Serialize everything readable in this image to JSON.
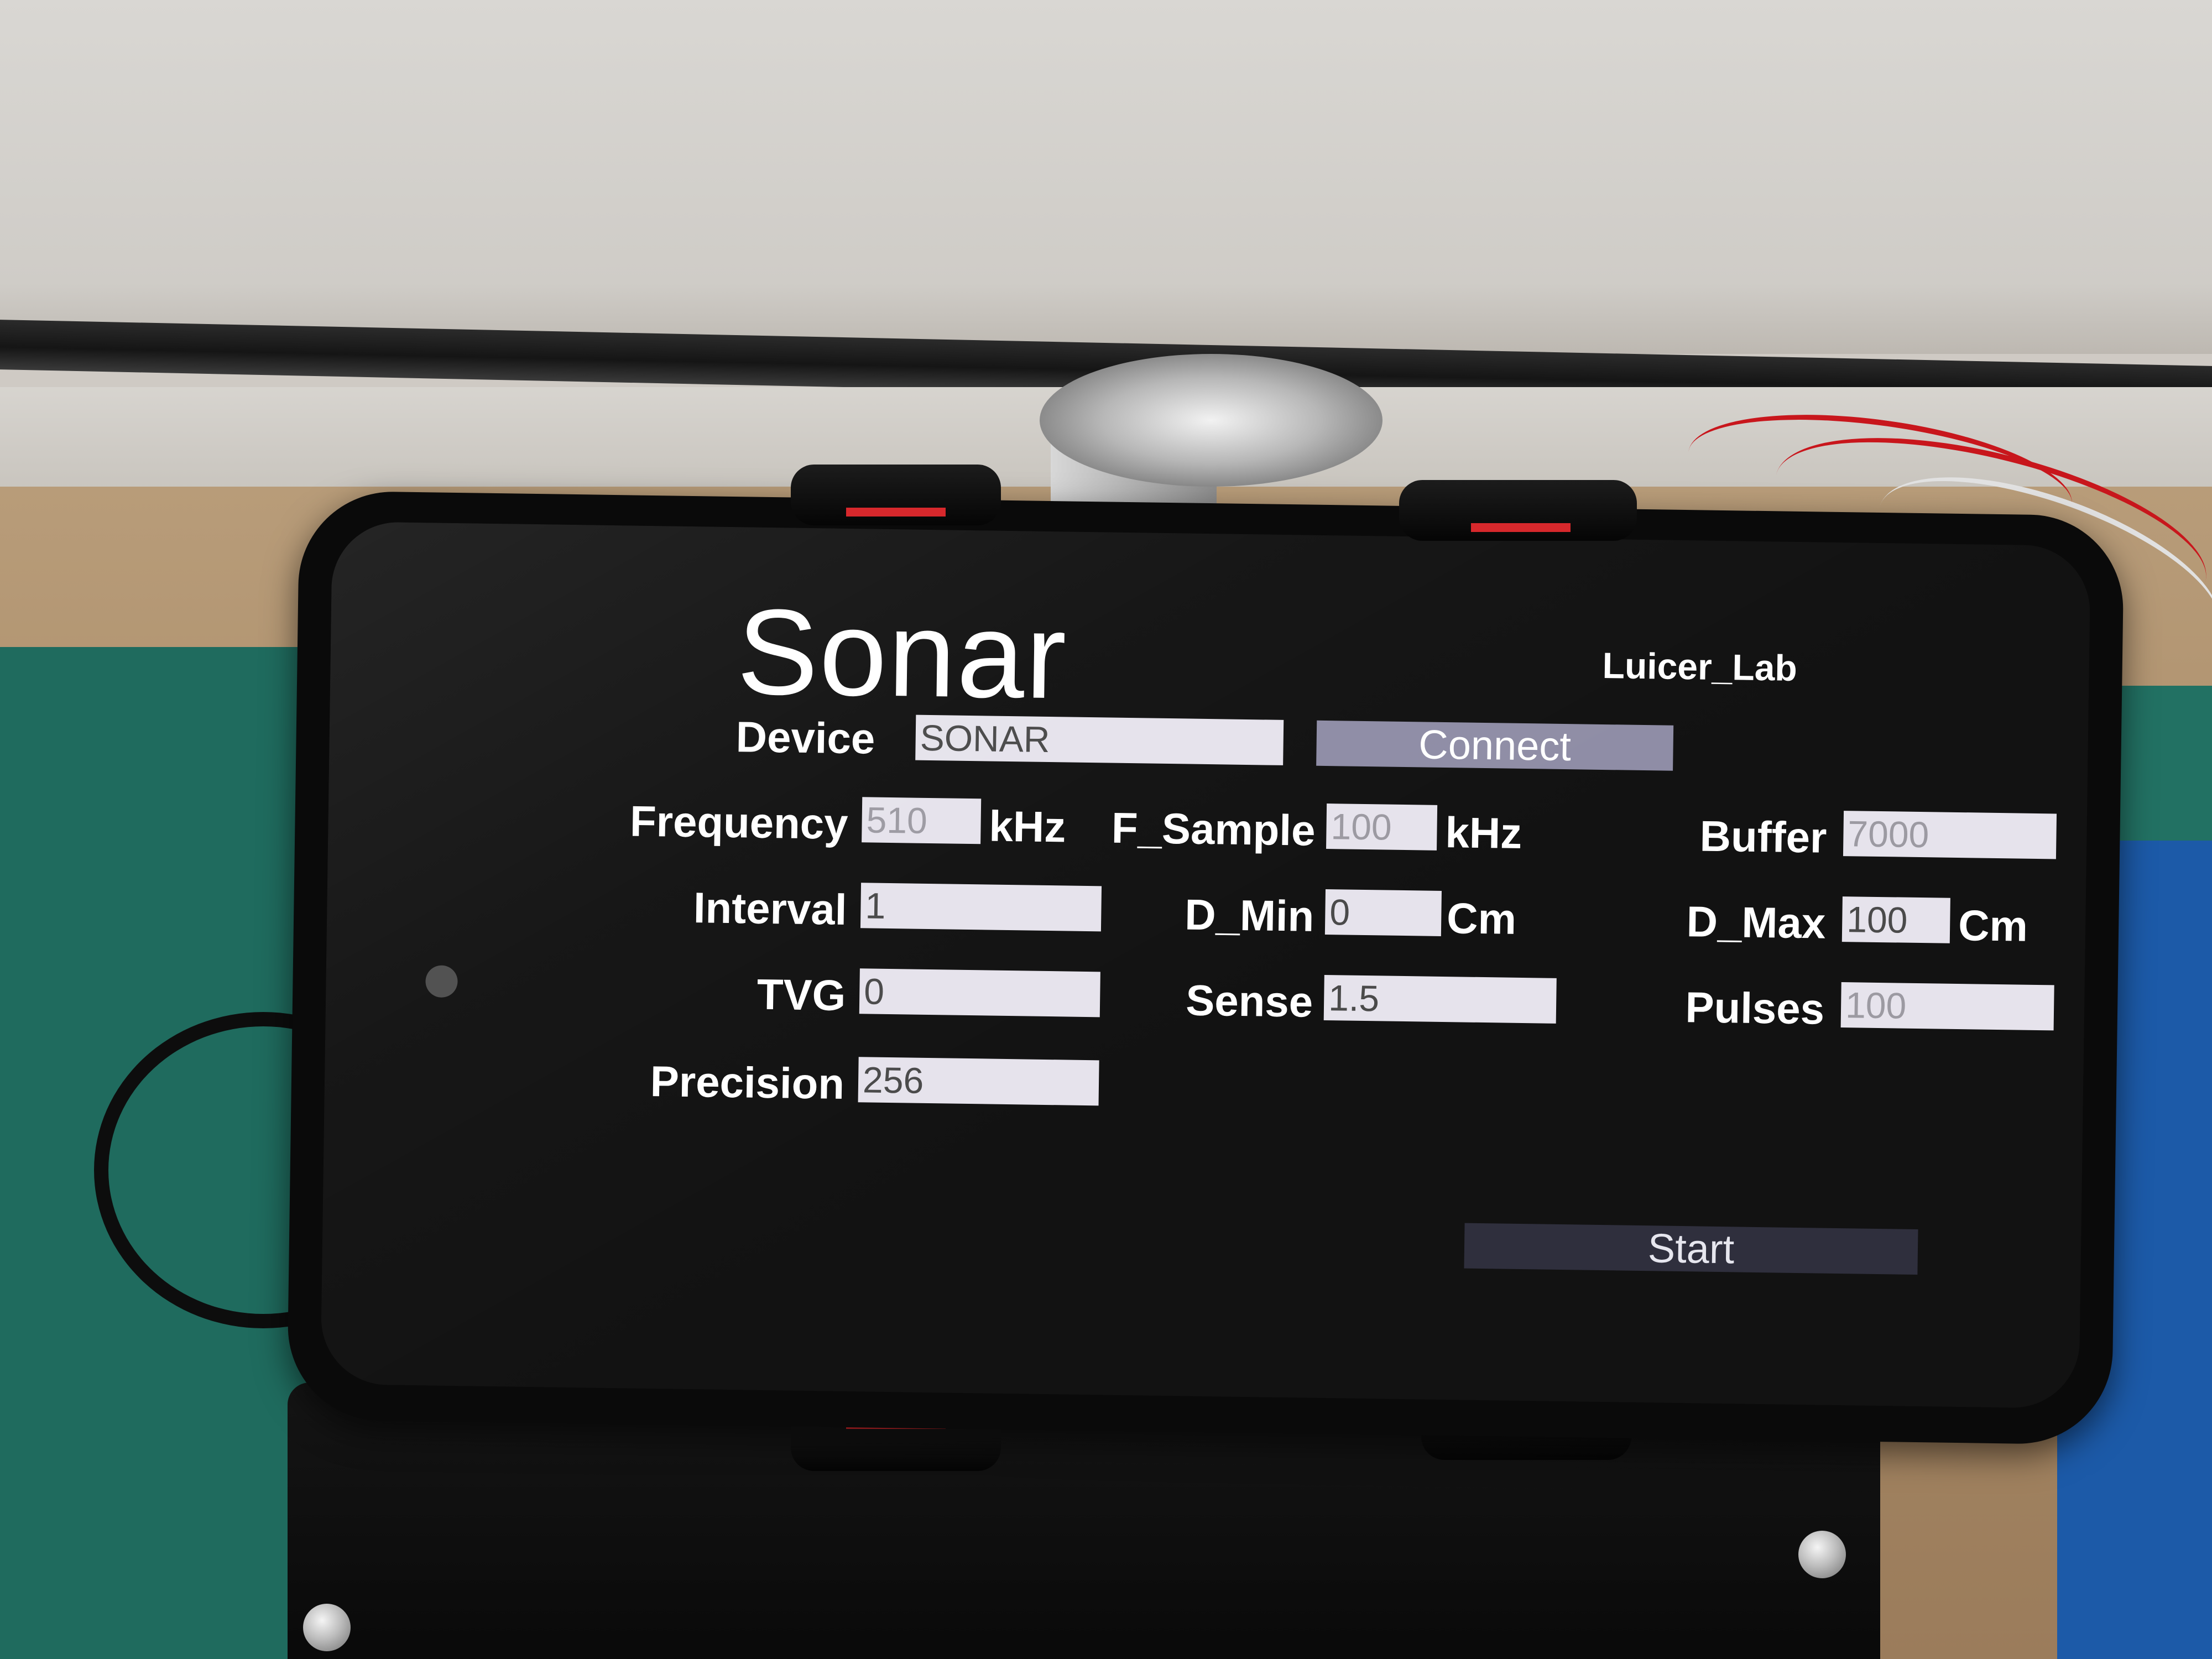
{
  "app": {
    "title": "Sonar",
    "brand": "Luicer_Lab"
  },
  "device": {
    "label": "Device",
    "value": "SONAR",
    "connect_label": "Connect"
  },
  "fields": {
    "frequency": {
      "label": "Frequency",
      "value": "510",
      "unit": "kHz"
    },
    "f_sample": {
      "label": "F_Sample",
      "value": "100",
      "unit": "kHz"
    },
    "buffer": {
      "label": "Buffer",
      "value": "7000"
    },
    "interval": {
      "label": "Interval",
      "value": "1"
    },
    "d_min": {
      "label": "D_Min",
      "value": "0",
      "unit": "Cm"
    },
    "d_max": {
      "label": "D_Max",
      "value": "100",
      "unit": "Cm"
    },
    "tvg": {
      "label": "TVG",
      "value": "0"
    },
    "sense": {
      "label": "Sense",
      "value": "1.5"
    },
    "pulses": {
      "label": "Pulses",
      "value": "100"
    },
    "precision": {
      "label": "Precision",
      "value": "256"
    }
  },
  "actions": {
    "start_label": "Start"
  },
  "colors": {
    "field_background": "#e6e3ec",
    "connect_button": "#8f8da6",
    "start_button": "#2f2f3d",
    "screen_background": "#121212"
  }
}
